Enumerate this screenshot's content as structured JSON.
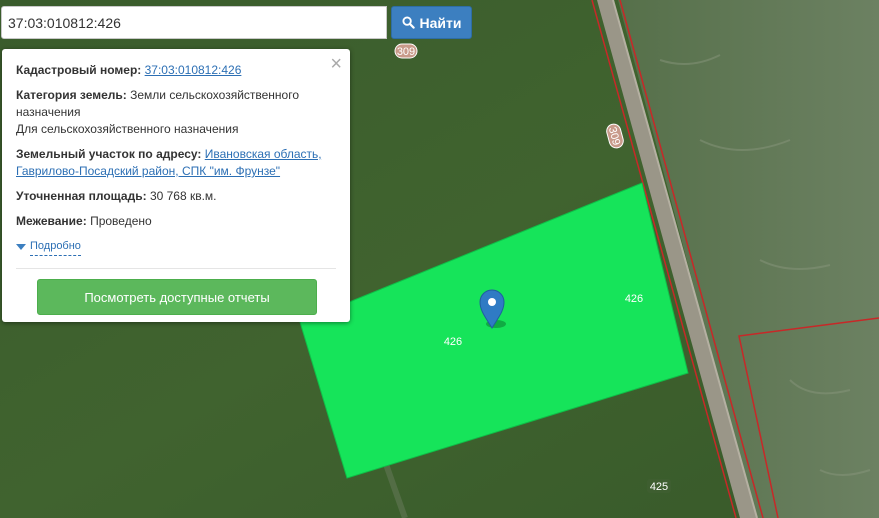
{
  "search": {
    "value": "37:03:010812:426",
    "button_label": "Найти"
  },
  "popup": {
    "cadastral_label": "Кадастровый номер:",
    "cadastral_value": "37:03:010812:426",
    "category_label": "Категория земель:",
    "category_value": "Земли сельскохозяйственного назначения",
    "category_sub": "Для сельскохозяйственного назначения",
    "address_label": "Земельный участок по адресу:",
    "address_value": "Ивановская область, Гаврилово-Посадский район, СПК \"им. Фрунзе\"",
    "area_label": "Уточненная площадь:",
    "area_value": "30 768 кв.м.",
    "survey_label": "Межевание:",
    "survey_value": "Проведено",
    "details_link": "Подробно",
    "report_button": "Посмотреть доступные отчеты",
    "close_glyph": "×"
  },
  "map": {
    "labels": {
      "road_top": "309",
      "road_side": "309",
      "parcel_main": "426",
      "parcel_main_inner": "426",
      "parcel_bottom": "425"
    },
    "colors": {
      "parcel_fill": "#16e45a",
      "boundary": "#c82828",
      "marker": "#2f7bc4"
    }
  }
}
